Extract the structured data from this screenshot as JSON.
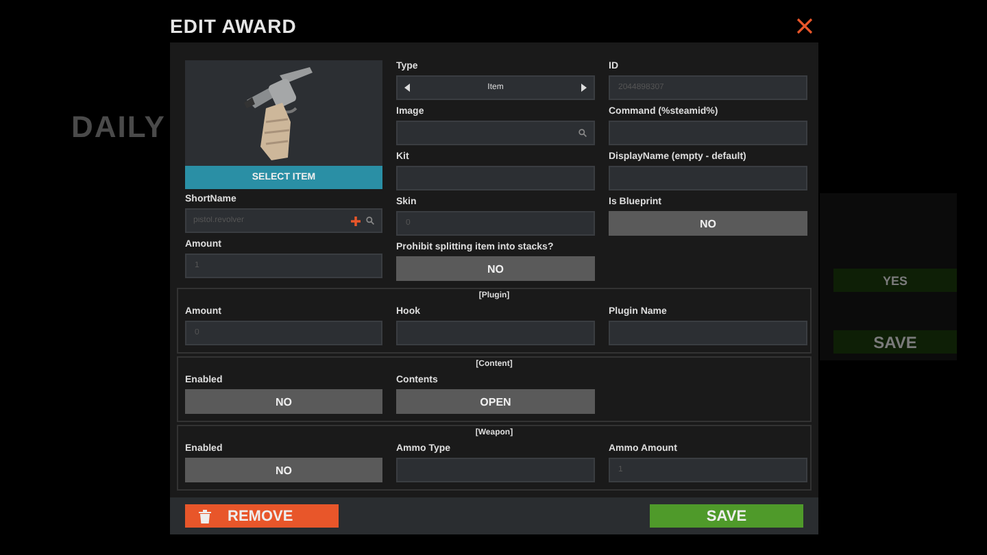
{
  "background": {
    "heading": "DAILY",
    "buttons": [
      {
        "label": "YES"
      },
      {
        "label": "SAVE"
      }
    ]
  },
  "dialog": {
    "title": "EDIT AWARD",
    "item_panel": {
      "button": "SELECT ITEM",
      "shortname": {
        "label": "ShortName",
        "placeholder": "pistol.revolver"
      },
      "amount": {
        "label": "Amount",
        "placeholder": "1"
      }
    },
    "middle_fields": [
      {
        "kind": "selector",
        "label": "Type",
        "value": "Item"
      },
      {
        "kind": "search",
        "label": "Image"
      },
      {
        "kind": "input",
        "label": "Kit"
      },
      {
        "kind": "input",
        "label": "Skin",
        "placeholder": "0"
      },
      {
        "kind": "toggle",
        "label": "Prohibit splitting item into stacks?",
        "value": "NO",
        "on": false
      }
    ],
    "right_fields": [
      {
        "kind": "input",
        "label": "ID",
        "placeholder": "2044898307"
      },
      {
        "kind": "input",
        "label": "Command (%steamid%)"
      },
      {
        "kind": "input",
        "label": "DisplayName (empty - default)"
      },
      {
        "kind": "toggle",
        "label": "Is Blueprint",
        "value": "NO",
        "on": false
      }
    ],
    "sections": [
      {
        "title": "[Plugin]",
        "fields": [
          {
            "kind": "input",
            "label": "Amount",
            "placeholder": "0"
          },
          {
            "kind": "input",
            "label": "Hook"
          },
          {
            "kind": "input",
            "label": "Plugin Name"
          }
        ]
      },
      {
        "title": "[Content]",
        "fields": [
          {
            "kind": "toggle",
            "label": "Enabled",
            "value": "NO",
            "on": false
          },
          {
            "kind": "button",
            "label": "Contents",
            "value": "OPEN"
          }
        ]
      },
      {
        "title": "[Weapon]",
        "fields": [
          {
            "kind": "toggle",
            "label": "Enabled",
            "value": "NO",
            "on": false
          },
          {
            "kind": "input",
            "label": "Ammo Type"
          },
          {
            "kind": "input",
            "label": "Ammo Amount",
            "placeholder": "1"
          }
        ]
      }
    ],
    "remove_button": "REMOVE",
    "save_button": "SAVE"
  }
}
